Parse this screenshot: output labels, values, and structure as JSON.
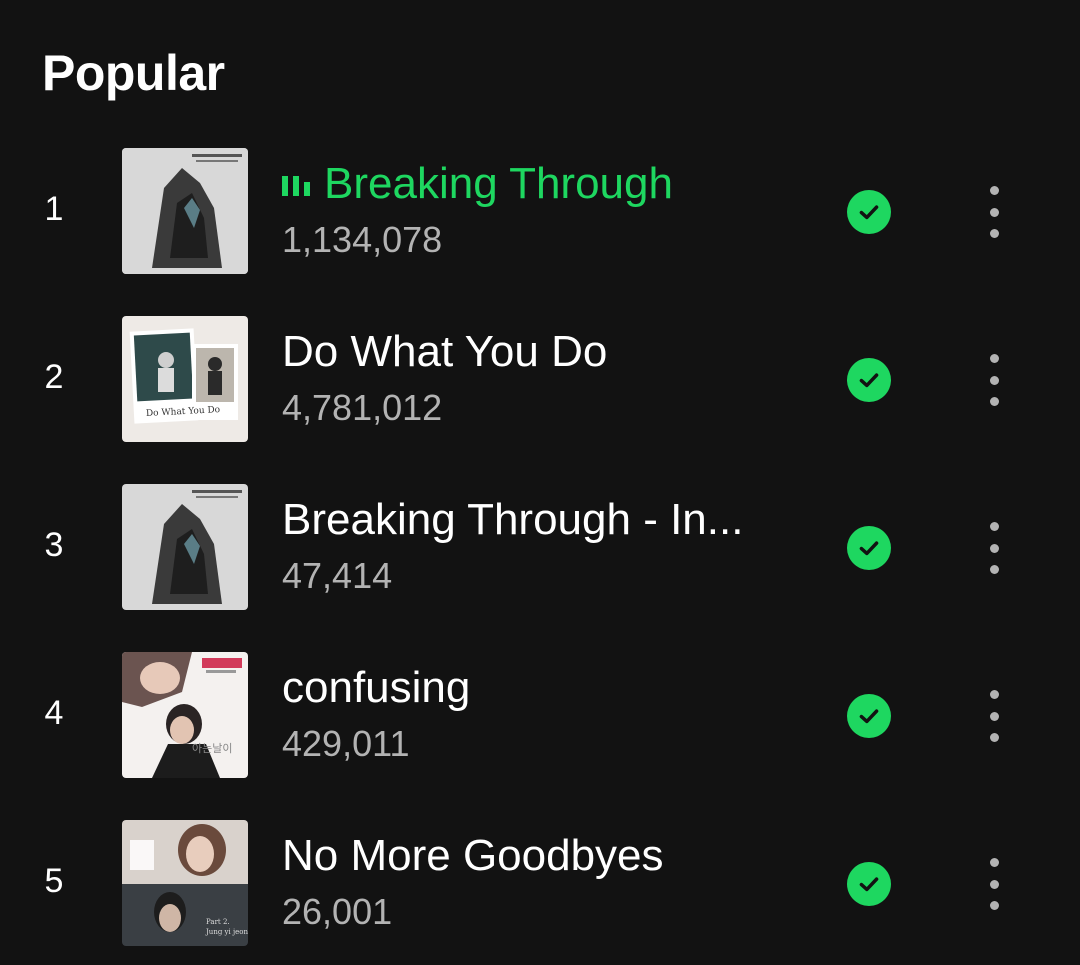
{
  "section": {
    "title": "Popular"
  },
  "colors": {
    "accent": "#1ed760",
    "background": "#121212",
    "secondary_text": "#b3b3b3"
  },
  "tracks": [
    {
      "rank": "1",
      "title": "Breaking Through",
      "plays": "1,134,078",
      "playing": true,
      "downloaded": true
    },
    {
      "rank": "2",
      "title": "Do What You Do",
      "plays": "4,781,012",
      "playing": false,
      "downloaded": true
    },
    {
      "rank": "3",
      "title": "Breaking Through - In...",
      "plays": "47,414",
      "playing": false,
      "downloaded": true
    },
    {
      "rank": "4",
      "title": "confusing",
      "plays": "429,011",
      "playing": false,
      "downloaded": true
    },
    {
      "rank": "5",
      "title": "No More Goodbyes",
      "plays": "26,001",
      "playing": false,
      "downloaded": true
    }
  ],
  "icons": {
    "now_playing": "equalizer-bars-icon",
    "downloaded": "check-circle-icon",
    "more": "more-vertical-icon"
  }
}
